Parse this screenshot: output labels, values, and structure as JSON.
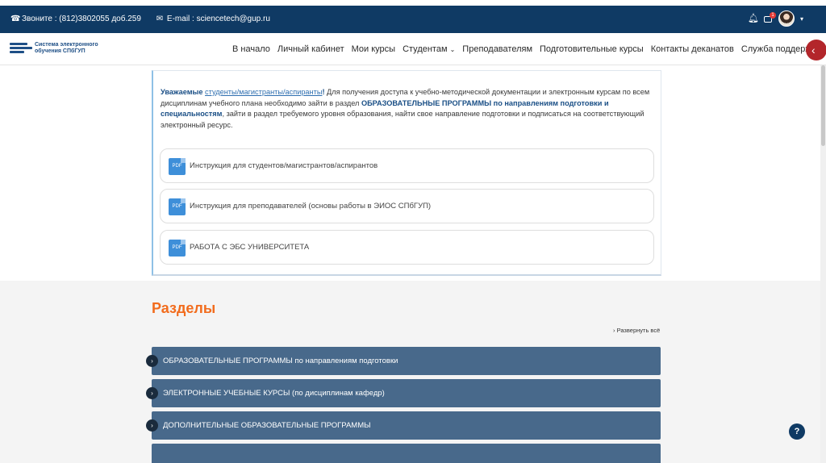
{
  "topbar": {
    "phone_text": "Звоните : (812)3802055 доб.259",
    "email_text": "E-mail : sciencetech@gup.ru",
    "message_badge": "1",
    "icons": [
      "phone-icon",
      "mail-icon",
      "bell-icon",
      "message-icon"
    ]
  },
  "logo": {
    "line1": "Система электронного",
    "line2": "обучения СПбГУП"
  },
  "nav": {
    "items": [
      "В начало",
      "Личный кабинет",
      "Мои курсы",
      "Студентам",
      "Преподавателям",
      "Подготовительные курсы",
      "Контакты деканатов",
      "Служба поддержки"
    ],
    "caret": "⌄",
    "collapse": "‹"
  },
  "intro": {
    "lead": "Уважаемые",
    "audience": "студенты/магистранты/аспиранты",
    "excl": "!",
    "text1": " Для получения доступа к учебно-методической документации и электронным курсам по всем дисциплинам учебного плана необходимо зайти в раздел ",
    "bold1": "ОБРАЗОВАТЕЛЬНЫЕ ПРОГРАММЫ по направлениям подготовки и специальностям",
    "text2": ", зайти в раздел требуемого уровня образования, найти свое направление подготовки и подписаться на соответствующий электронный ресурс."
  },
  "files": [
    {
      "label": "Инструкция для студентов/магистрантов/аспирантов",
      "icon": "pdf-icon"
    },
    {
      "label": "Инструкция для преподавателей (основы работы в ЭИОС СПбГУП)",
      "icon": "pdf-icon"
    },
    {
      "label": "РАБОТА С ЭБС УНИВЕРСИТЕТА",
      "icon": "pdf-icon"
    }
  ],
  "sections": {
    "title": "Разделы",
    "expand_all": "Развернуть всё",
    "items": [
      "ОБРАЗОВАТЕЛЬНЫЕ ПРОГРАММЫ по направлениям подготовки",
      "ЭЛЕКТРОННЫЕ УЧЕБНЫЕ КУРСЫ (по дисциплинам кафедр)",
      "ДОПОЛНИТЕЛЬНЫЕ ОБРАЗОВАТЕЛЬНЫЕ ПРОГРАММЫ",
      ""
    ]
  },
  "help": "?",
  "colors": {
    "topbar": "#0f3a64",
    "accent_orange": "#f26c1d",
    "accordion": "#48698b",
    "collapse_red": "#b3262b",
    "pdf_blue": "#3e8fd9"
  }
}
